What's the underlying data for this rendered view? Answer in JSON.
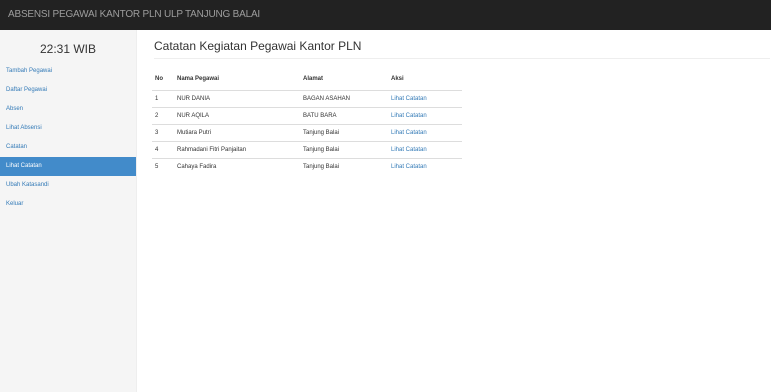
{
  "header": {
    "title": "ABSENSI PEGAWAI KANTOR PLN ULP TANJUNG BALAI"
  },
  "sidebar": {
    "clock": "22:31 WIB",
    "items": [
      {
        "label": "Tambah Pegawai"
      },
      {
        "label": "Daftar Pegawai"
      },
      {
        "label": "Absen"
      },
      {
        "label": "Lihat Absensi"
      },
      {
        "label": "Catatan"
      },
      {
        "label": "Lihat Catatan",
        "active": true
      },
      {
        "label": "Ubah Katasandi"
      },
      {
        "label": "Keluar"
      }
    ]
  },
  "main": {
    "title": "Catatan Kegiatan Pegawai Kantor PLN",
    "table": {
      "headers": {
        "no": "No",
        "nama": "Nama Pegawai",
        "alamat": "Alamat",
        "aksi": "Aksi"
      },
      "rows": [
        {
          "no": "1",
          "nama": "NUR DANIA",
          "alamat": "BAGAN ASAHAN",
          "aksi": "Lihat Catatan"
        },
        {
          "no": "2",
          "nama": "NUR AQILA",
          "alamat": "BATU BARA",
          "aksi": "Lihat Catatan"
        },
        {
          "no": "3",
          "nama": "Mutiara Putri",
          "alamat": "Tanjung Balai",
          "aksi": "Lihat Catatan"
        },
        {
          "no": "4",
          "nama": "Rahmadani Fitri Panjaitan",
          "alamat": "Tanjung Balai",
          "aksi": "Lihat Catatan"
        },
        {
          "no": "5",
          "nama": "Cahaya Fadira",
          "alamat": "Tanjung Balai",
          "aksi": "Lihat Catatan"
        }
      ]
    }
  }
}
